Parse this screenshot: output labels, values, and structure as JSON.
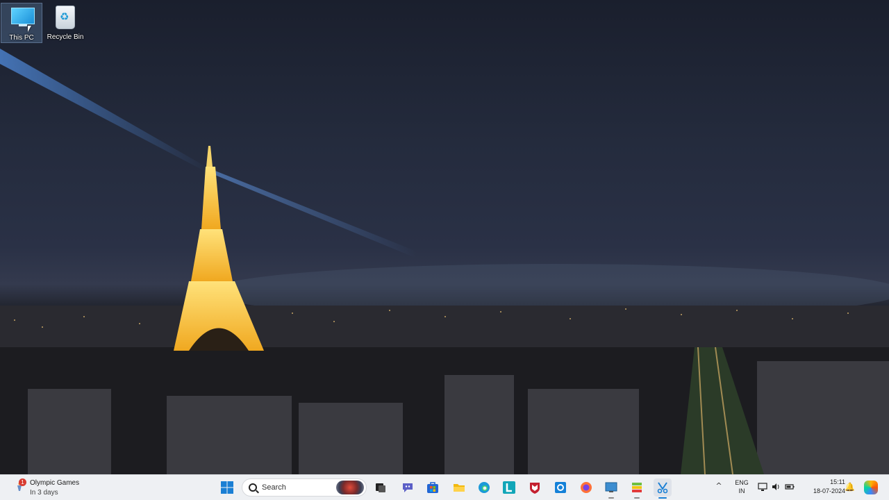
{
  "desktop": {
    "icons": [
      {
        "label": "This PC",
        "icon": "computer-icon"
      },
      {
        "label": "Recycle Bin",
        "icon": "recycle-bin-icon"
      }
    ],
    "wallpaper": "night-eiffel-tower"
  },
  "taskbar": {
    "widget": {
      "title": "Olympic Games",
      "subtitle": "In 3 days",
      "badge": "1",
      "icon": "olympic-torch-icon"
    },
    "search": {
      "placeholder": "Search"
    },
    "apps": [
      {
        "name": "windows-start-icon",
        "color": "#1a7fd4"
      },
      {
        "name": "task-view-icon",
        "color": "#222222"
      },
      {
        "name": "teams-chat-icon",
        "color": "#5b5fc7"
      },
      {
        "name": "microsoft-store-icon",
        "color": "#2266d4"
      },
      {
        "name": "file-explorer-icon",
        "color": "#f2b90f"
      },
      {
        "name": "edge-icon",
        "color": "#1b9ad8"
      },
      {
        "name": "l-app-icon",
        "color": "#11a6b8"
      },
      {
        "name": "mcafee-icon",
        "color": "#c4202f"
      },
      {
        "name": "outlook-icon",
        "color": "#1481d8"
      },
      {
        "name": "firefox-icon",
        "color": "#ff7139"
      },
      {
        "name": "remote-desktop-icon",
        "color": "#3c8dd0"
      },
      {
        "name": "bluestacks-icon",
        "color": "#6fbf3f"
      },
      {
        "name": "snipping-tool-icon",
        "color": "#1a7fd4"
      }
    ],
    "tray": {
      "language_line1": "ENG",
      "language_line2": "IN",
      "time": "15:11",
      "date": "18-07-2024"
    }
  }
}
